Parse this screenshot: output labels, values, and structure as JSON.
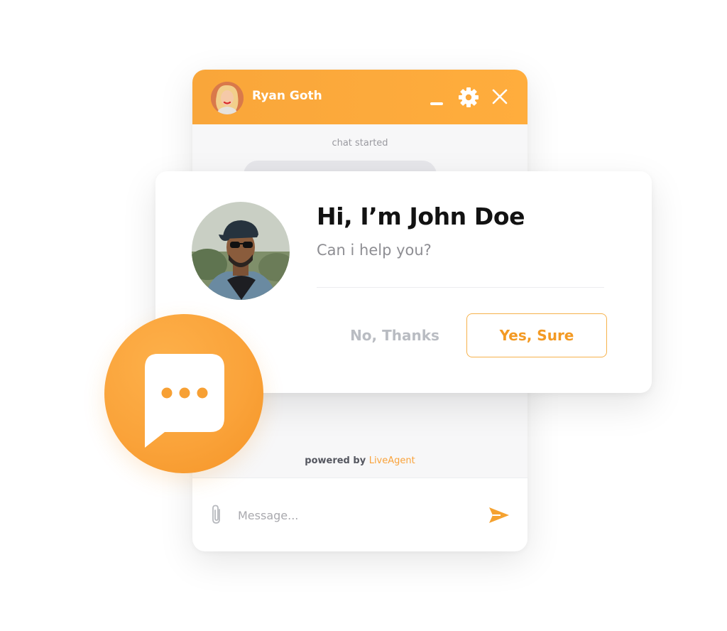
{
  "chat_window": {
    "agent_name": "Ryan Goth",
    "chat_started_label": "chat started",
    "powered_by_prefix": "powered by",
    "powered_by_brand": "LiveAgent",
    "message_placeholder": "Message..."
  },
  "invite": {
    "greeting": "Hi, I’m John Doe",
    "subtext": "Can i help you?",
    "decline_label": "No, Thanks",
    "accept_label": "Yes, Sure"
  },
  "theme": {
    "accent": "#f9a63a",
    "accent_dark": "#f39a24",
    "muted_text": "#b9bcc2"
  },
  "icons": {
    "minimize": "minimize-icon",
    "settings": "gear-icon",
    "close": "close-icon",
    "attach": "paperclip-icon",
    "send": "send-icon",
    "launcher": "chat-bubble-icon"
  }
}
